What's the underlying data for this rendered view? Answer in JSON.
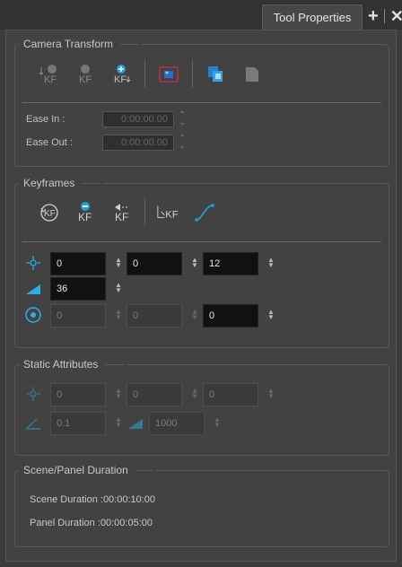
{
  "tab": {
    "title": "Tool Properties"
  },
  "camera_transform": {
    "title": "Camera Transform",
    "ease_in_label": "Ease In :",
    "ease_in_value": "0:00:00.00",
    "ease_out_label": "Ease Out :",
    "ease_out_value": "0:00:00.00"
  },
  "keyframes": {
    "title": "Keyframes",
    "position": {
      "x": "0",
      "y": "0",
      "z": "12"
    },
    "angle": "36",
    "scale": {
      "x": "0",
      "y": "0",
      "z": "0"
    }
  },
  "static_attributes": {
    "title": "Static Attributes",
    "position": {
      "x": "0",
      "y": "0",
      "z": "0"
    },
    "skew": "0.1",
    "fov": "1000"
  },
  "duration": {
    "title": "Scene/Panel Duration",
    "scene_label": "Scene Duration :",
    "scene_value": "00:00:10:00",
    "panel_label": "Panel Duration :",
    "panel_value": "00:00:05:00"
  },
  "colors": {
    "accent": "#2ab0e6",
    "selected_icon": "#d23a5a"
  }
}
